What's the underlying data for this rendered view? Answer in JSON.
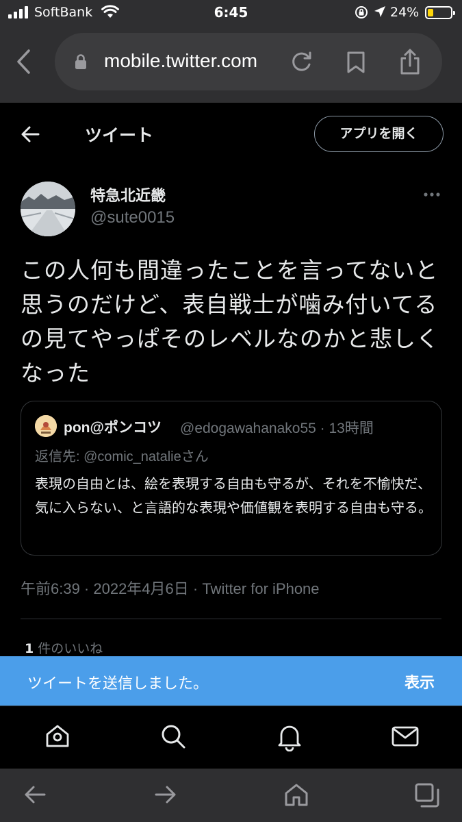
{
  "status_bar": {
    "carrier": "SoftBank",
    "time": "6:45",
    "battery_percent": "24%",
    "battery_level": 0.24,
    "icons": [
      "signal-icon",
      "wifi-icon",
      "orientation-lock-icon",
      "location-icon",
      "battery-icon"
    ]
  },
  "browser": {
    "url": "mobile.twitter.com",
    "icons": [
      "back-icon",
      "lock-icon",
      "reload-icon",
      "bookmark-icon",
      "share-icon"
    ]
  },
  "header": {
    "title": "ツイート",
    "open_app_label": "アプリを開く"
  },
  "tweet": {
    "author_name": "特急北近畿",
    "author_handle": "@sute0015",
    "text": "この人何も間違ったことを言ってないと思うのだけど、表自戦士が噛み付いてるの見てやっぱそのレベルなのかと悲しくなった",
    "meta": "午前6:39 · 2022年4月6日 · Twitter for iPhone",
    "likes_count": "1",
    "likes_label": " 件のいいね"
  },
  "quote": {
    "author_name": "pon@ポンコツ",
    "author_handle": "@edogawahanako55 · 13時間",
    "reply_prefix": "返信先: ",
    "reply_mention": "@comic_natalie",
    "reply_suffix": "さん",
    "text": "表現の自由とは、絵を表現する自由も守るが、それを不愉快だ、気に入らない、と言語的な表現や価値観を表明する自由も守る。"
  },
  "toast": {
    "message": "ツイートを送信しました。",
    "action": "表示",
    "color": "#4b9eea"
  },
  "bottom_nav": [
    "home-icon",
    "search-icon",
    "notifications-icon",
    "messages-icon"
  ],
  "browser_toolbar": [
    "back-arrow-icon",
    "forward-arrow-icon",
    "home-icon",
    "tabs-icon"
  ]
}
